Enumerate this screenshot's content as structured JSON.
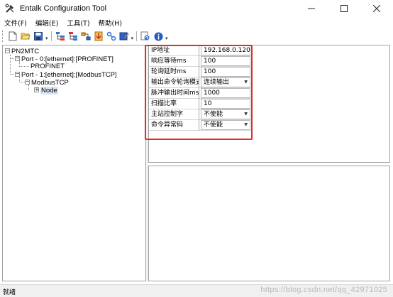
{
  "window": {
    "title": "Entalk Configuration Tool",
    "icon": "tools-icon",
    "controls": {
      "minimize": "—",
      "maximize": "☐",
      "close": "✕"
    }
  },
  "menu": {
    "items": [
      {
        "label": "文件(F)"
      },
      {
        "label": "编辑(E)"
      },
      {
        "label": "工具(T)"
      },
      {
        "label": "帮助(H)"
      }
    ]
  },
  "toolbar": {
    "buttons": [
      "new-file-icon",
      "open-folder-icon",
      "save-icon",
      "tree-config-icon",
      "device-list-icon",
      "network-icon",
      "import-icon",
      "link-icon",
      "edit-icon",
      "refresh-icon",
      "info-icon"
    ],
    "overflow": "▾"
  },
  "tree": {
    "root": {
      "label": "PN2MTC",
      "expander": "−"
    },
    "port0": {
      "label": "Port - 0:[ethernet]:[PROFINET]",
      "expander": "−"
    },
    "profinet": {
      "label": "PROFINET"
    },
    "port1": {
      "label": "Port - 1:[ethernet]:[ModbusTCP]",
      "expander": "−"
    },
    "modbustcp": {
      "label": "ModbusTCP",
      "expander": "−"
    },
    "node": {
      "label": "Node",
      "expander": "+"
    }
  },
  "properties": [
    {
      "name": "IP地址",
      "value": "192.168.0.120",
      "type": "text"
    },
    {
      "name": "响应等待ms",
      "value": "100",
      "type": "text"
    },
    {
      "name": "轮询延时ms",
      "value": "100",
      "type": "text"
    },
    {
      "name": "输出命令轮询模式",
      "value": "连续输出",
      "type": "dropdown"
    },
    {
      "name": "脉冲输出时间ms",
      "value": "1000",
      "type": "text"
    },
    {
      "name": "扫描比率",
      "value": "10",
      "type": "text"
    },
    {
      "name": "主站控制字",
      "value": "不使能",
      "type": "dropdown"
    },
    {
      "name": "命令异常码",
      "value": "不使能",
      "type": "dropdown"
    }
  ],
  "status": {
    "text": "就绪",
    "watermark": "https://blog.csdn.net/qq_42971025"
  },
  "colors": {
    "highlight": "#e32b2b",
    "selection": "#dde6f3"
  }
}
